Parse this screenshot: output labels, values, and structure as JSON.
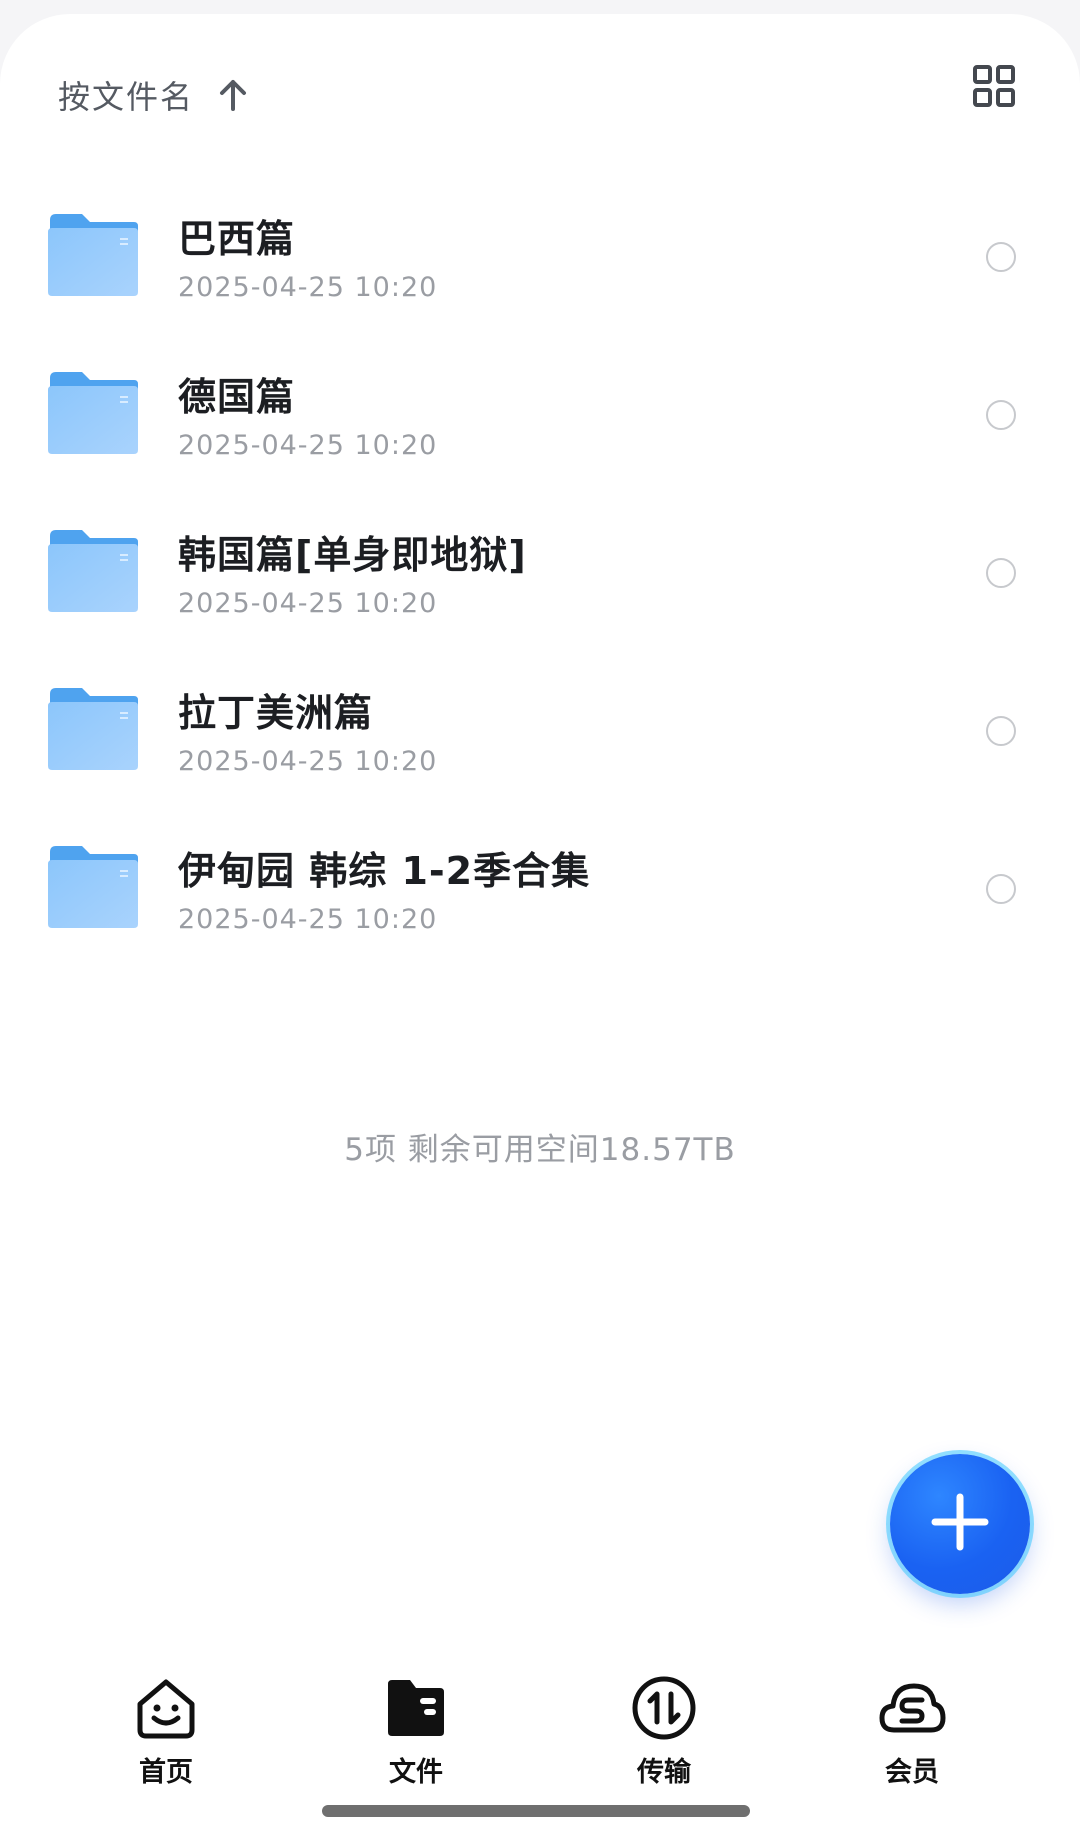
{
  "colors": {
    "accent": "#1a62f2",
    "folder": "#6ab4f5",
    "text_primary": "#1c1e22",
    "text_secondary": "#9a9da3"
  },
  "sort": {
    "label": "按文件名",
    "direction_icon": "arrow-up-icon"
  },
  "view_toggle": {
    "icon": "grid-view-icon"
  },
  "files": [
    {
      "name": "巴西篇",
      "date": "2025-04-25 10:20",
      "icon": "folder-icon"
    },
    {
      "name": "德国篇",
      "date": "2025-04-25 10:20",
      "icon": "folder-icon"
    },
    {
      "name": "韩国篇[单身即地狱]",
      "date": "2025-04-25 10:20",
      "icon": "folder-icon"
    },
    {
      "name": "拉丁美洲篇",
      "date": "2025-04-25 10:20",
      "icon": "folder-icon"
    },
    {
      "name": "伊甸园 韩综 1-2季合集",
      "date": "2025-04-25 10:20",
      "icon": "folder-icon"
    }
  ],
  "summary": "5项 剩余可用空间18.57TB",
  "fab": {
    "icon": "plus-icon"
  },
  "tabs": [
    {
      "label": "首页",
      "icon": "home-face-icon",
      "active": false
    },
    {
      "label": "文件",
      "icon": "file-folder-icon",
      "active": true
    },
    {
      "label": "传输",
      "icon": "transfer-icon",
      "active": false
    },
    {
      "label": "会员",
      "icon": "membership-cloud-icon",
      "active": false
    }
  ]
}
